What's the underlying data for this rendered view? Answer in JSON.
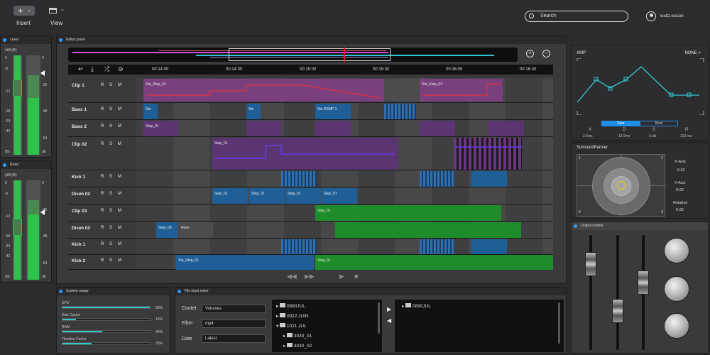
{
  "toolbar": {
    "insert_label": "Insert",
    "view_label": "View",
    "search_placeholder": "Search",
    "username": "waltz.wason"
  },
  "level_panel": {
    "title": "Level",
    "scale_labels": [
      "0",
      "-6",
      "-12",
      "-18",
      "-24",
      "-42",
      "-∞"
    ],
    "right_labels": [
      "0",
      "-36",
      "-48",
      "-53",
      "db"
    ],
    "header_left": "(dB)",
    "header_right": "(B)",
    "bottom_left": "(B)",
    "bottom_right": "db"
  },
  "road_panel": {
    "title": "Road",
    "header_left": "(dB)",
    "header_right": "(B)",
    "scale_labels": [
      "0",
      "-6",
      "-12",
      "-18",
      "-24",
      "-42",
      "-∞"
    ],
    "right_labels": [
      "0",
      "-36",
      "-48",
      "-53",
      "db"
    ],
    "bottom_left": "(B)",
    "bottom_right": "db"
  },
  "editor": {
    "title": "Editor panel",
    "timecodes": [
      "00:14:00",
      "00:14:30",
      "00:15:00",
      "00:15:30",
      "00:16:00",
      "00:16:30"
    ],
    "tracks": [
      {
        "name": "Clip 1",
        "r": "R",
        "s": "S",
        "m": "M"
      },
      {
        "name": "Bass 1",
        "r": "R",
        "s": "S",
        "m": "M"
      },
      {
        "name": "Bass 2",
        "r": "R",
        "s": "S",
        "m": "M"
      },
      {
        "name": "Clip 02",
        "r": "R",
        "s": "S",
        "m": "M"
      },
      {
        "name": "Kick 1",
        "r": "R",
        "s": "S",
        "m": "M"
      },
      {
        "name": "Drum 02",
        "r": "R",
        "s": "S",
        "m": "M"
      },
      {
        "name": "Clip 03",
        "r": "R",
        "s": "S",
        "m": "M"
      },
      {
        "name": "Drum 02",
        "r": "R",
        "s": "S",
        "m": "M"
      },
      {
        "name": "Kick 1",
        "r": "R",
        "s": "S",
        "m": "M"
      },
      {
        "name": "Kick 2",
        "r": "R",
        "s": "S",
        "m": "M"
      }
    ],
    "clips": {
      "c1a": "Ste_Step_03",
      "c1b": "Ste_Step_03",
      "b1a": "Ste",
      "b1b": "Ste",
      "b1c": "Ste RSMP 1",
      "b2a": "Step_01",
      "c2a": "Step_01",
      "d1a": "Step_01",
      "d1b": "Step_01",
      "d1c": "Step_01",
      "d1d": "Step_01",
      "c3a": "Step_01",
      "d2a": "Step_05",
      "d2b": "None",
      "k2a": "Ste_Step_01",
      "k2b": "Step_01"
    }
  },
  "amp": {
    "label": "AMP",
    "none": "NONE >",
    "tab_time": "Time",
    "tab_beat": "Beat",
    "params": [
      {
        "k": "A",
        "v": "2.6ms"
      },
      {
        "k": "D",
        "v": "12.9ms"
      },
      {
        "k": "S",
        "v": "-3 db"
      },
      {
        "k": "R",
        "v": "102 ms"
      }
    ]
  },
  "surround": {
    "title": "SurroundPanner",
    "x_label": "X-Axis",
    "x_value": "-0.32",
    "y_label": "Y-Axis",
    "y_value": "0.00",
    "rot_label": "Rotation",
    "rot_value": "0.00",
    "corners": [
      "1",
      "2",
      "3",
      "4"
    ]
  },
  "output": {
    "title": "Output control"
  },
  "system": {
    "title": "System usage",
    "items": [
      {
        "label": "CPU",
        "pct": "99%",
        "frac": 0.99
      },
      {
        "label": "Disk Cache",
        "pct": "15%",
        "frac": 0.15
      },
      {
        "label": "RAM",
        "pct": "45%",
        "frac": 0.45
      },
      {
        "label": "Timeline Cache",
        "pct": "33%",
        "frac": 0.33
      }
    ]
  },
  "file": {
    "title": "File input mixer",
    "content_label": "Contet",
    "content_value": "Volumes",
    "filter_label": "Filter",
    "filter_value": "mp4",
    "date_label": "Date",
    "date_value": "Latest",
    "tree": [
      "0890JUL",
      "0922 JUIN",
      "1021 JUL",
      "3030_01",
      "3030_02"
    ],
    "right_tree": [
      "0890JUL"
    ]
  },
  "colors": {
    "accent": "#2a9df4",
    "meter": "#2ec24a",
    "green_clip": "#1f8c2b",
    "blue_clip": "#1f5f97",
    "pink_clip": "#7a3f7d"
  }
}
